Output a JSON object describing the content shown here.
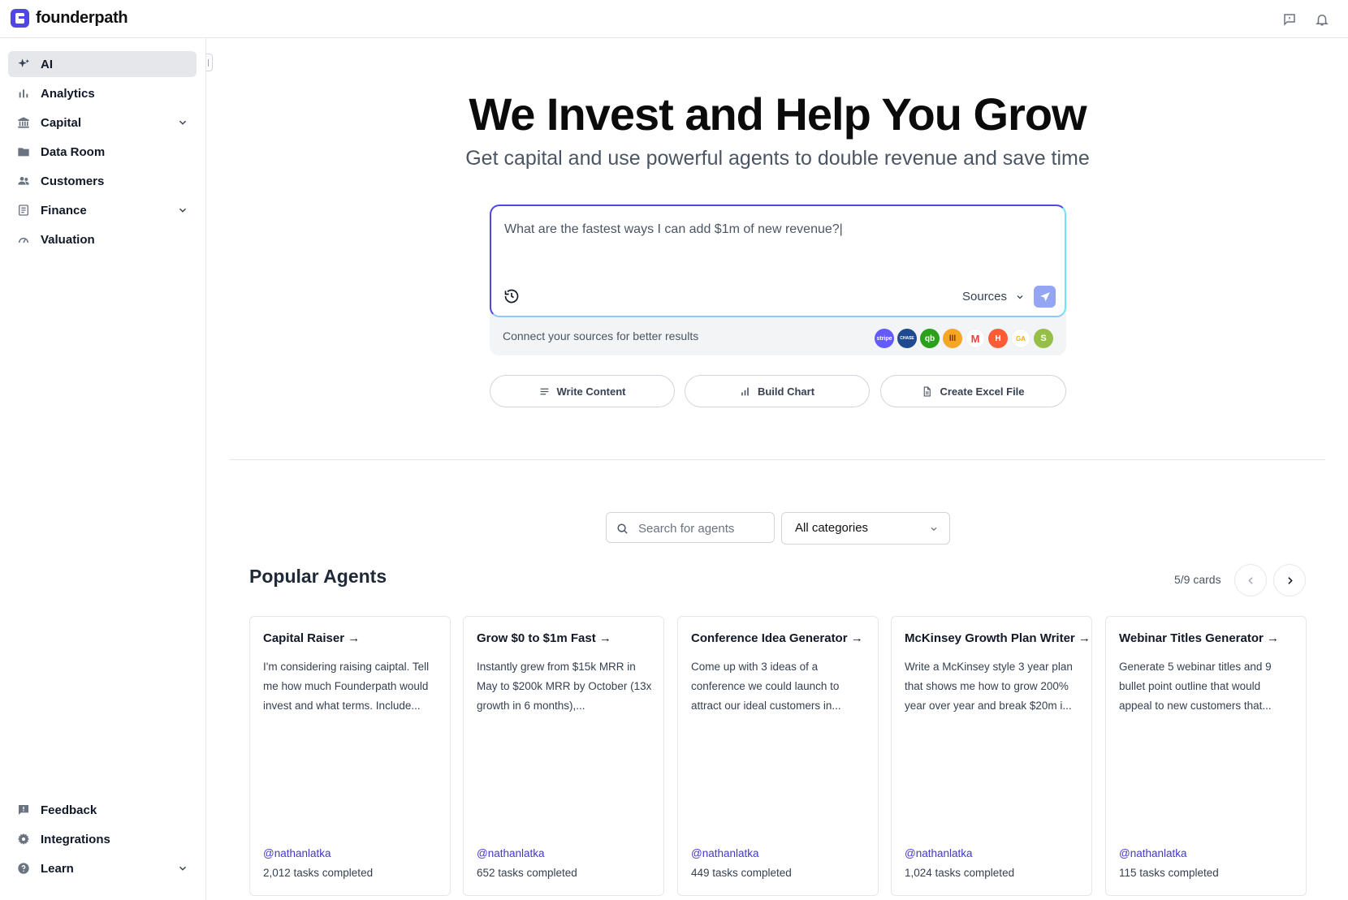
{
  "app": {
    "logo_text": "founderpath"
  },
  "sidebar": {
    "items": [
      {
        "label": "AI",
        "icon": "sparkles-icon",
        "active": true
      },
      {
        "label": "Analytics",
        "icon": "bar-chart-icon"
      },
      {
        "label": "Capital",
        "icon": "bank-icon",
        "expandable": true
      },
      {
        "label": "Data Room",
        "icon": "folder-icon"
      },
      {
        "label": "Customers",
        "icon": "people-icon"
      },
      {
        "label": "Finance",
        "icon": "ledger-icon",
        "expandable": true
      },
      {
        "label": "Valuation",
        "icon": "gauge-icon"
      }
    ],
    "bottom_items": [
      {
        "label": "Feedback",
        "icon": "feedback-icon"
      },
      {
        "label": "Integrations",
        "icon": "gear-icon"
      },
      {
        "label": "Learn",
        "icon": "help-circle-icon",
        "expandable": true
      }
    ]
  },
  "hero": {
    "title": "We Invest and Help You Grow",
    "subtitle": "Get capital and use powerful agents to double revenue and save time"
  },
  "prompt": {
    "value": "What are the fastest ways I can add $1m of new revenue?|",
    "sources_label": "Sources",
    "connect_text": "Connect your sources for better results",
    "integrations": [
      {
        "name": "stripe",
        "label": "stripe",
        "color": "#635bff"
      },
      {
        "name": "chase",
        "label": "CHASE",
        "color": "#1e4a8f"
      },
      {
        "name": "quickbooks",
        "label": "qb",
        "color": "#2ca01c"
      },
      {
        "name": "chartmogul",
        "label": "lll",
        "color": "#f5a623"
      },
      {
        "name": "gmail",
        "label": "M",
        "color": "#ffffff"
      },
      {
        "name": "hubspot",
        "label": "H",
        "color": "#ff5c35"
      },
      {
        "name": "google-analytics",
        "label": "GA",
        "color": "#ffffff"
      },
      {
        "name": "shopify",
        "label": "S",
        "color": "#95bf47"
      }
    ]
  },
  "actions": [
    {
      "label": "Write Content",
      "icon": "lines-icon"
    },
    {
      "label": "Build Chart",
      "icon": "bar-chart-icon"
    },
    {
      "label": "Create Excel File",
      "icon": "file-icon"
    }
  ],
  "agents": {
    "search_placeholder": "Search for agents",
    "category_selected": "All categories",
    "section_title": "Popular Agents",
    "cards_count": "5/9 cards",
    "cards": [
      {
        "title": "Capital Raiser →",
        "desc": "I'm considering raising caiptal. Tell me how much Founderpath would invest and what terms. Include...",
        "author": "@nathanlatka",
        "tasks": "2,012 tasks completed"
      },
      {
        "title": "Grow $0 to $1m Fast →",
        "desc": "Instantly grew from $15k MRR in May to $200k MRR by October (13x growth in 6 months),...",
        "author": "@nathanlatka",
        "tasks": "652 tasks completed"
      },
      {
        "title": "Conference Idea Generator →",
        "desc": "Come up with 3 ideas of a conference we could launch to attract our ideal customers in...",
        "author": "@nathanlatka",
        "tasks": "449 tasks completed"
      },
      {
        "title": "McKinsey Growth Plan Writer →",
        "desc": "Write a McKinsey style 3 year plan that shows me how to grow 200% year over year and break $20m i...",
        "author": "@nathanlatka",
        "tasks": "1,024 tasks completed"
      },
      {
        "title": "Webinar Titles Generator →",
        "desc": "Generate 5 webinar titles and 9 bullet point outline that would appeal to new customers that...",
        "author": "@nathanlatka",
        "tasks": "115 tasks completed"
      }
    ]
  },
  "colors": {
    "accent": "#4f46e5",
    "author_link": "#4338ca",
    "active_nav": "#e5e7eb"
  }
}
